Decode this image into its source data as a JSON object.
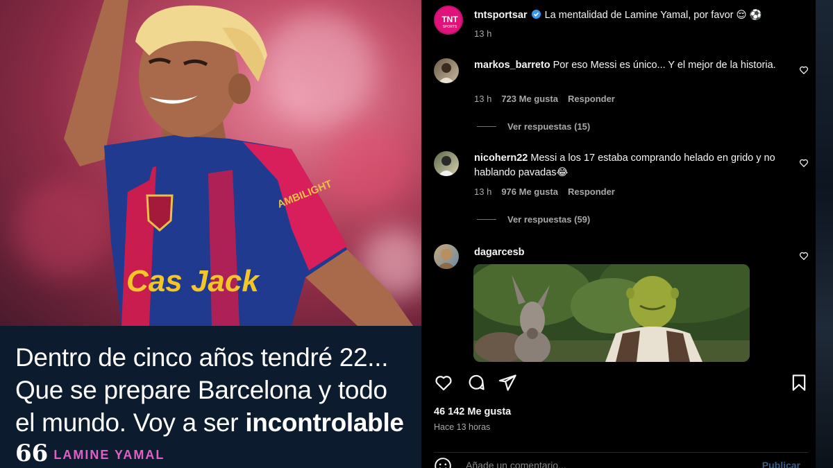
{
  "post_image": {
    "quote_lines": [
      "Dentro de cinco años tendré 22...",
      "Que se prepare Barcelona y todo",
      "el mundo. Voy a ser "
    ],
    "quote_emphasis": "incontrolable",
    "quote_mark": "66",
    "author": "LAMINE YAMAL",
    "shirt_sponsor": "AMBILIGHT",
    "shirt_print": "Cas Jack"
  },
  "post": {
    "author": "tntsportsar",
    "avatar_label": "TNT SPORTS",
    "caption": "La mentalidad de Lamine Yamal, por favor",
    "caption_emoji": "😌 ⚽",
    "time": "13 h",
    "likes": "46 142 Me gusta",
    "time_ago": "Hace 13 horas",
    "add_comment_placeholder": "Añade un comentario...",
    "publish_label": "Publicar"
  },
  "comments": [
    {
      "user": "markos_barreto",
      "text": "Por eso Messi es único... Y el mejor de la historia.",
      "time": "13 h",
      "likes": "723 Me gusta",
      "reply": "Responder",
      "view_replies": "Ver respuestas (15)"
    },
    {
      "user": "nicohern22",
      "text": "Messi a los 17 estaba comprando helado en grido y no hablando pavadas",
      "emoji": "😂",
      "time": "13 h",
      "likes": "976 Me gusta",
      "reply": "Responder",
      "view_replies": "Ver respuestas (59)"
    },
    {
      "user": "dagarcesb",
      "text": ""
    }
  ],
  "colors": {
    "panel_bg": "#000000",
    "accent_pink": "#e060c8",
    "verified": "#3897f0",
    "publish": "#3b5c86"
  }
}
